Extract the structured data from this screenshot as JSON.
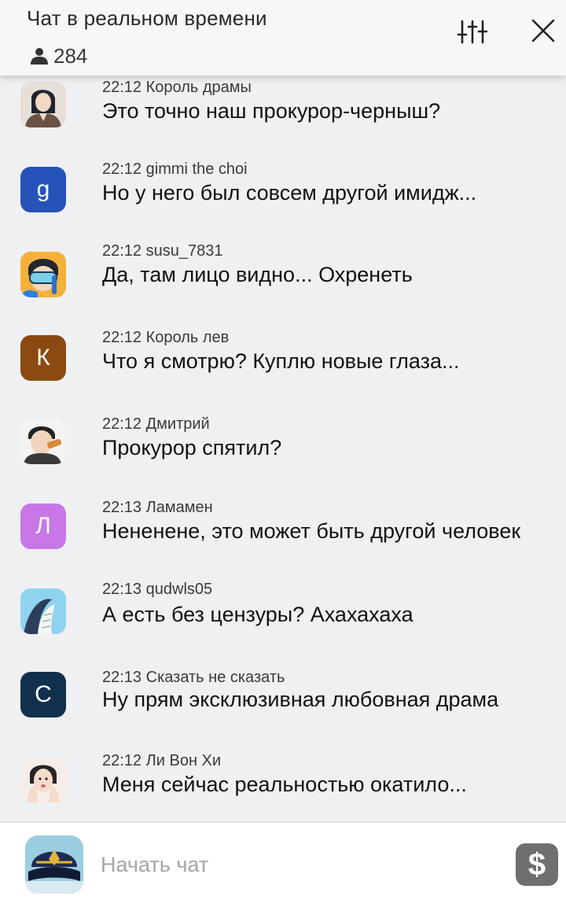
{
  "header": {
    "title": "Чат в реальном времени",
    "viewer_count": "284"
  },
  "messages": [
    {
      "time": "22:12",
      "user": "Король драмы",
      "text": "Это точно наш прокурор-черныш?",
      "avatar": {
        "type": "image",
        "icon": "drama-king-avatar"
      }
    },
    {
      "time": "22:12",
      "user": "gimmi the choi",
      "text": "Но у него был совсем другой имидж...",
      "avatar": {
        "type": "letter",
        "letter": "g",
        "color": "#2553b8"
      }
    },
    {
      "time": "22:12",
      "user": "susu_7831",
      "text": "Да, там лицо видно... Охренеть",
      "avatar": {
        "type": "image",
        "icon": "diver-avatar"
      }
    },
    {
      "time": "22:12",
      "user": "Король лев",
      "text": "Что я смотрю? Куплю новые глаза...",
      "avatar": {
        "type": "letter",
        "letter": "К",
        "color": "#8a4a12"
      }
    },
    {
      "time": "22:12",
      "user": "Дмитрий",
      "text": "Прокурор спятил?",
      "avatar": {
        "type": "image",
        "icon": "eating-man-avatar"
      }
    },
    {
      "time": "22:13",
      "user": "Ламамен",
      "text": "Нененене, это может быть другой человек",
      "avatar": {
        "type": "letter",
        "letter": "Л",
        "color": "#c778e6"
      }
    },
    {
      "time": "22:13",
      "user": "qudwls05",
      "text": "А есть без цензуры? Ахахахаха",
      "avatar": {
        "type": "image",
        "icon": "whale-avatar"
      }
    },
    {
      "time": "22:13",
      "user": "Сказать не сказать",
      "text": "Ну прям эксклюзивная любовная драма",
      "avatar": {
        "type": "letter",
        "letter": "С",
        "color": "#10304d"
      }
    },
    {
      "time": "22:12",
      "user": "Ли Вон Хи",
      "text": "Меня сейчас реальностью окатило...",
      "avatar": {
        "type": "image",
        "icon": "woman-avatar"
      }
    }
  ],
  "footer": {
    "placeholder": "Начать чат",
    "coin_symbol": "$"
  },
  "colors": {
    "background": "#eff0f2",
    "header": "#f7f7f8",
    "coin_button": "#6f6f6f"
  }
}
